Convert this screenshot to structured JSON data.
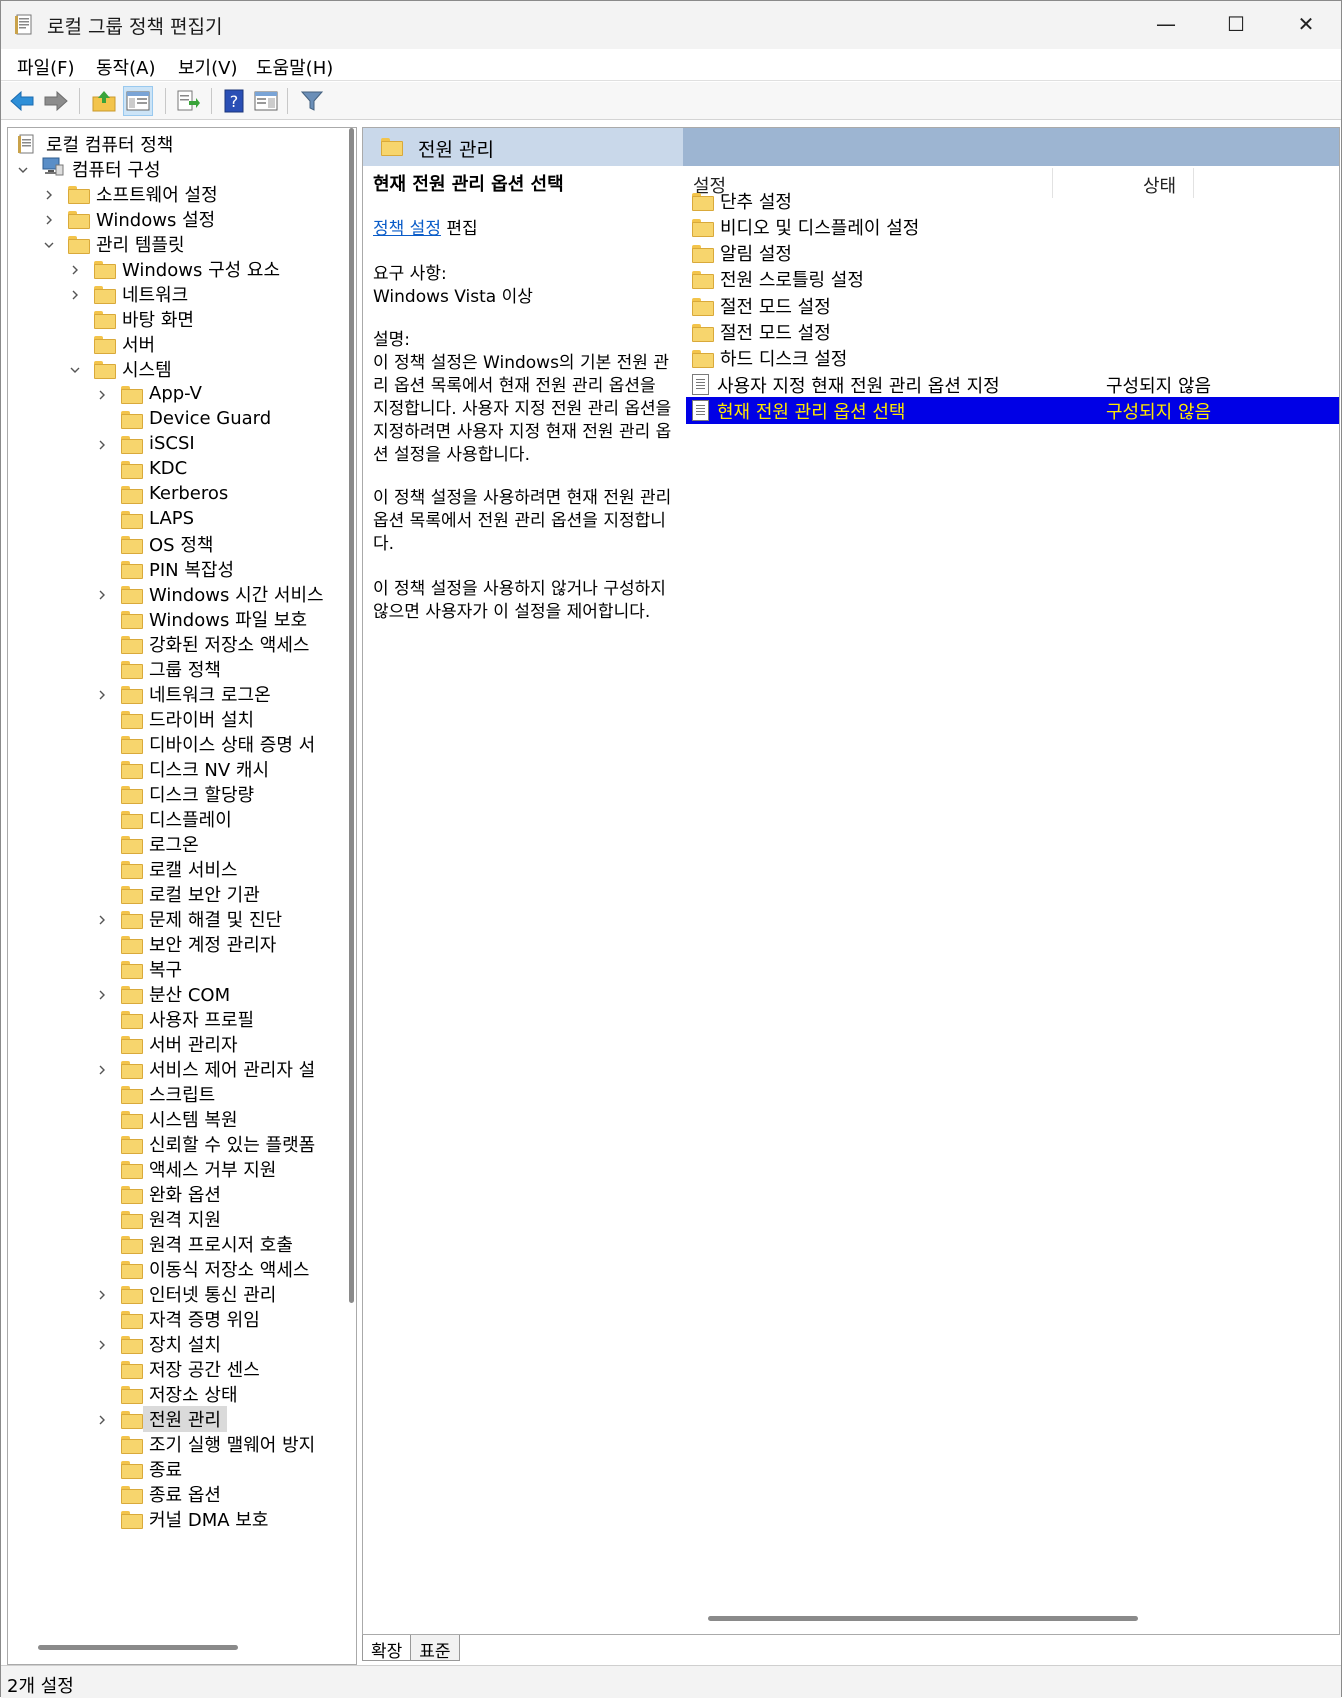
{
  "window": {
    "title": "로컬 그룹 정책 편집기",
    "minimize_glyph": "—",
    "maximize_glyph": "☐",
    "close_glyph": "✕"
  },
  "menu": [
    "파일(F)",
    "동작(A)",
    "보기(V)",
    "도움말(H)"
  ],
  "toolbar": {
    "icons": [
      "back-arrow-icon",
      "forward-arrow-icon",
      "up-folder-icon",
      "show-tree-icon",
      "export-list-icon",
      "help-icon",
      "view-panel-icon",
      "filter-icon"
    ]
  },
  "tree": {
    "root": "로컬 컴퓨터 정책",
    "items": [
      {
        "label": "컴퓨터 구성",
        "level": 1,
        "expander": "expanded",
        "icon": "computer-icon"
      },
      {
        "label": "소프트웨어 설정",
        "level": 2,
        "expander": "collapsed"
      },
      {
        "label": "Windows 설정",
        "level": 2,
        "expander": "collapsed"
      },
      {
        "label": "관리 템플릿",
        "level": 2,
        "expander": "expanded"
      },
      {
        "label": "Windows 구성 요소",
        "level": 3,
        "expander": "collapsed"
      },
      {
        "label": "네트워크",
        "level": 3,
        "expander": "collapsed"
      },
      {
        "label": "바탕 화면",
        "level": 3,
        "expander": "none"
      },
      {
        "label": "서버",
        "level": 3,
        "expander": "none"
      },
      {
        "label": "시스템",
        "level": 3,
        "expander": "expanded"
      },
      {
        "label": "App-V",
        "level": 4,
        "expander": "collapsed"
      },
      {
        "label": "Device Guard",
        "level": 4,
        "expander": "none"
      },
      {
        "label": "iSCSI",
        "level": 4,
        "expander": "collapsed"
      },
      {
        "label": "KDC",
        "level": 4,
        "expander": "none"
      },
      {
        "label": "Kerberos",
        "level": 4,
        "expander": "none"
      },
      {
        "label": "LAPS",
        "level": 4,
        "expander": "none"
      },
      {
        "label": "OS 정책",
        "level": 4,
        "expander": "none"
      },
      {
        "label": "PIN 복잡성",
        "level": 4,
        "expander": "none"
      },
      {
        "label": "Windows 시간 서비스",
        "level": 4,
        "expander": "collapsed"
      },
      {
        "label": "Windows 파일 보호",
        "level": 4,
        "expander": "none"
      },
      {
        "label": "강화된 저장소 액세스",
        "level": 4,
        "expander": "none"
      },
      {
        "label": "그룹 정책",
        "level": 4,
        "expander": "none"
      },
      {
        "label": "네트워크 로그온",
        "level": 4,
        "expander": "collapsed"
      },
      {
        "label": "드라이버 설치",
        "level": 4,
        "expander": "none"
      },
      {
        "label": "디바이스 상태 증명 서",
        "level": 4,
        "expander": "none"
      },
      {
        "label": "디스크 NV 캐시",
        "level": 4,
        "expander": "none"
      },
      {
        "label": "디스크 할당량",
        "level": 4,
        "expander": "none"
      },
      {
        "label": "디스플레이",
        "level": 4,
        "expander": "none"
      },
      {
        "label": "로그온",
        "level": 4,
        "expander": "none"
      },
      {
        "label": "로캘 서비스",
        "level": 4,
        "expander": "none"
      },
      {
        "label": "로컬 보안 기관",
        "level": 4,
        "expander": "none"
      },
      {
        "label": "문제 해결 및 진단",
        "level": 4,
        "expander": "collapsed"
      },
      {
        "label": "보안 계정 관리자",
        "level": 4,
        "expander": "none"
      },
      {
        "label": "복구",
        "level": 4,
        "expander": "none"
      },
      {
        "label": "분산 COM",
        "level": 4,
        "expander": "collapsed"
      },
      {
        "label": "사용자 프로필",
        "level": 4,
        "expander": "none"
      },
      {
        "label": "서버 관리자",
        "level": 4,
        "expander": "none"
      },
      {
        "label": "서비스 제어 관리자 설",
        "level": 4,
        "expander": "collapsed"
      },
      {
        "label": "스크립트",
        "level": 4,
        "expander": "none"
      },
      {
        "label": "시스템 복원",
        "level": 4,
        "expander": "none"
      },
      {
        "label": "신뢰할 수 있는 플랫폼",
        "level": 4,
        "expander": "none"
      },
      {
        "label": "액세스 거부 지원",
        "level": 4,
        "expander": "none"
      },
      {
        "label": "완화 옵션",
        "level": 4,
        "expander": "none"
      },
      {
        "label": "원격 지원",
        "level": 4,
        "expander": "none"
      },
      {
        "label": "원격 프로시저 호출",
        "level": 4,
        "expander": "none"
      },
      {
        "label": "이동식 저장소 액세스",
        "level": 4,
        "expander": "none"
      },
      {
        "label": "인터넷 통신 관리",
        "level": 4,
        "expander": "collapsed"
      },
      {
        "label": "자격 증명 위임",
        "level": 4,
        "expander": "none"
      },
      {
        "label": "장치 설치",
        "level": 4,
        "expander": "collapsed"
      },
      {
        "label": "저장 공간 센스",
        "level": 4,
        "expander": "none"
      },
      {
        "label": "저장소 상태",
        "level": 4,
        "expander": "none"
      },
      {
        "label": "전원 관리",
        "level": 4,
        "expander": "collapsed",
        "selected": true
      },
      {
        "label": "조기 실행 맬웨어 방지",
        "level": 4,
        "expander": "none"
      },
      {
        "label": "종료",
        "level": 4,
        "expander": "none"
      },
      {
        "label": "종료 옵션",
        "level": 4,
        "expander": "none"
      },
      {
        "label": "커널 DMA 보호",
        "level": 4,
        "expander": "none"
      }
    ]
  },
  "right": {
    "header_title": "전원 관리",
    "desc": {
      "title": "현재 전원 관리 옵션 선택",
      "edit_link": "정책 설정",
      "edit_suffix": " 편집",
      "req_label": "요구 사항:",
      "req_value": "Windows Vista 이상",
      "desc_label": "설명:",
      "para1": "이 정책 설정은 Windows의 기본 전원 관리 옵션 목록에서 현재 전원 관리 옵션을 지정합니다. 사용자 지정 전원 관리 옵션을 지정하려면 사용자 지정 현재 전원 관리 옵션 설정을 사용합니다.",
      "para2": "이 정책 설정을 사용하려면 현재 전원 관리 옵션 목록에서 전원 관리 옵션을 지정합니다.",
      "para3": "이 정책 설정을 사용하지 않거나 구성하지 않으면 사용자가 이 설정을 제어합니다."
    },
    "columns": {
      "setting": "설정",
      "state": "상태"
    },
    "rows": [
      {
        "label": "단추 설정",
        "type": "folder",
        "state": ""
      },
      {
        "label": "비디오 및 디스플레이 설정",
        "type": "folder",
        "state": ""
      },
      {
        "label": "알림 설정",
        "type": "folder",
        "state": ""
      },
      {
        "label": "전원 스로틀링 설정",
        "type": "folder",
        "state": ""
      },
      {
        "label": "절전 모드 설정",
        "type": "folder",
        "state": ""
      },
      {
        "label": "절전 모드 설정",
        "type": "folder",
        "state": ""
      },
      {
        "label": "하드 디스크 설정",
        "type": "folder",
        "state": ""
      },
      {
        "label": "사용자 지정 현재 전원 관리 옵션 지정",
        "type": "policy",
        "state": "구성되지 않음"
      },
      {
        "label": "현재 전원 관리 옵션 선택",
        "type": "policy",
        "state": "구성되지 않음",
        "selected": true
      }
    ],
    "tabs": [
      "확장",
      "표준"
    ]
  },
  "status": "2개 설정",
  "colors": {
    "selection_bg": "#0000E6",
    "selection_text": "#FFE800",
    "header_blue": "#9DB5D2",
    "link": "#0A5CC8",
    "folder": "#F7D56D"
  }
}
